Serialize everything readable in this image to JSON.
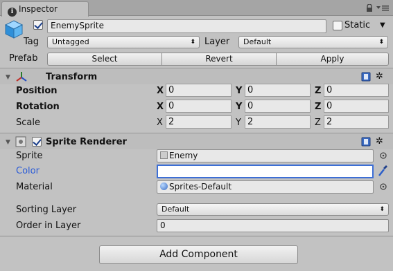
{
  "tab": {
    "title": "Inspector"
  },
  "object": {
    "active": true,
    "name": "EnemySprite",
    "static_label": "Static",
    "static_checked": false
  },
  "tag": {
    "label": "Tag",
    "value": "Untagged"
  },
  "layer": {
    "label": "Layer",
    "value": "Default"
  },
  "prefab": {
    "label": "Prefab",
    "select": "Select",
    "revert": "Revert",
    "apply": "Apply"
  },
  "transform": {
    "title": "Transform",
    "position": {
      "label": "Position",
      "x": "0",
      "y": "0",
      "z": "0"
    },
    "rotation": {
      "label": "Rotation",
      "x": "0",
      "y": "0",
      "z": "0"
    },
    "scale": {
      "label": "Scale",
      "x": "2",
      "y": "2",
      "z": "2"
    }
  },
  "axes": {
    "x": "X",
    "y": "Y",
    "z": "Z"
  },
  "sprite_renderer": {
    "title": "Sprite Renderer",
    "enabled": true,
    "sprite": {
      "label": "Sprite",
      "value": "Enemy"
    },
    "color": {
      "label": "Color",
      "value": "#ffffff"
    },
    "material": {
      "label": "Material",
      "value": "Sprites-Default"
    },
    "sorting_layer": {
      "label": "Sorting Layer",
      "value": "Default"
    },
    "order_in_layer": {
      "label": "Order in Layer",
      "value": "0"
    }
  },
  "add_component": "Add Component",
  "colors": {
    "accent_blue": "#2a5bd7",
    "panel_bg": "#c2c2c2"
  }
}
